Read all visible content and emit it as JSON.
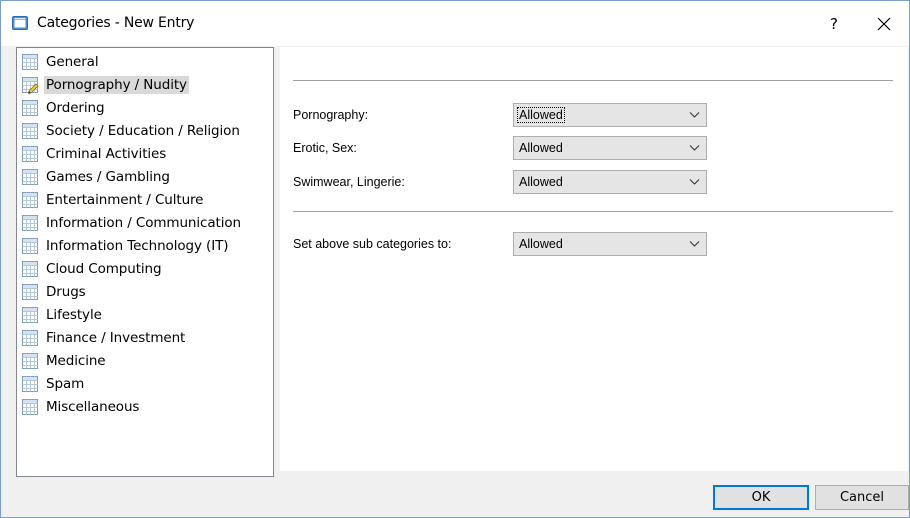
{
  "window": {
    "title": "Categories - New Entry",
    "help_label": "?",
    "icons": {
      "app": "app-window-icon",
      "close": "close-icon"
    }
  },
  "tree": {
    "selected_index": 1,
    "items": [
      {
        "label": "General",
        "icon": "grid-icon"
      },
      {
        "label": "Pornography / Nudity",
        "icon": "grid-edit-icon"
      },
      {
        "label": "Ordering",
        "icon": "grid-icon"
      },
      {
        "label": "Society / Education / Religion",
        "icon": "grid-icon"
      },
      {
        "label": "Criminal Activities",
        "icon": "grid-icon"
      },
      {
        "label": "Games / Gambling",
        "icon": "grid-icon"
      },
      {
        "label": "Entertainment / Culture",
        "icon": "grid-icon"
      },
      {
        "label": "Information / Communication",
        "icon": "grid-icon"
      },
      {
        "label": "Information Technology (IT)",
        "icon": "grid-icon"
      },
      {
        "label": "Cloud Computing",
        "icon": "grid-icon"
      },
      {
        "label": "Drugs",
        "icon": "grid-icon"
      },
      {
        "label": "Lifestyle",
        "icon": "grid-icon"
      },
      {
        "label": "Finance / Investment",
        "icon": "grid-icon"
      },
      {
        "label": "Medicine",
        "icon": "grid-icon"
      },
      {
        "label": "Spam",
        "icon": "grid-icon"
      },
      {
        "label": "Miscellaneous",
        "icon": "grid-icon"
      }
    ]
  },
  "panel": {
    "subcategories": [
      {
        "label": "Pornography:",
        "value": "Allowed",
        "focused": true
      },
      {
        "label": "Erotic, Sex:",
        "value": "Allowed",
        "focused": false
      },
      {
        "label": "Swimwear, Lingerie:",
        "value": "Allowed",
        "focused": false
      }
    ],
    "set_all": {
      "label": "Set above sub categories to:",
      "value": "Allowed"
    }
  },
  "buttons": {
    "ok": "OK",
    "cancel": "Cancel"
  },
  "colors": {
    "focus_blue": "#0078d7",
    "selection_gray": "#d9d9d9",
    "window_border": "#7a9cc7"
  }
}
